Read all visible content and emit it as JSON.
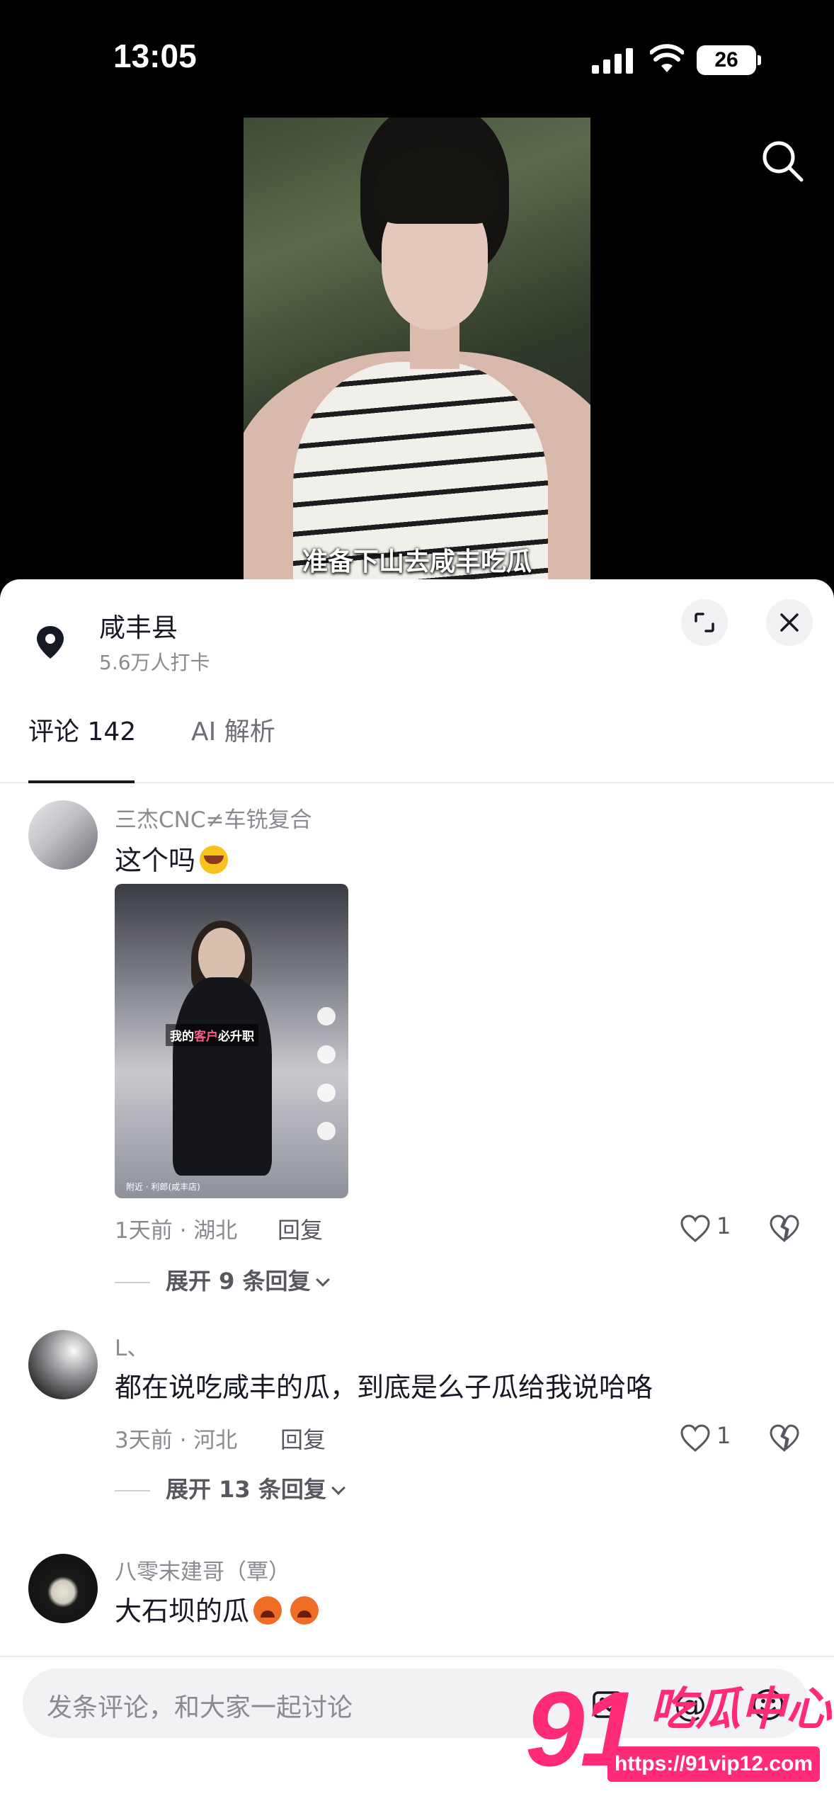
{
  "status_bar": {
    "time": "13:05",
    "battery": "26"
  },
  "video": {
    "caption": "准备下山去咸丰吃瓜"
  },
  "location": {
    "title": "咸丰县",
    "subtitle": "5.6万人打卡"
  },
  "tabs": [
    {
      "label": "评论 142"
    },
    {
      "label": "AI 解析"
    }
  ],
  "comments": [
    {
      "user": "三杰CNC≠车铣复合",
      "text": "这个吗",
      "emoji": "laughing-crying-emoji",
      "thumbnail": {
        "label_pre": "我的",
        "label_hl": "客户",
        "label_post": "必升职",
        "tag": "附近 · 利郎(咸丰店)"
      },
      "meta": "1天前 · 湖北",
      "reply_label": "回复",
      "likes": "1",
      "expand_label": "展开 9 条回复"
    },
    {
      "user": "L、",
      "text": "都在说吃咸丰的瓜，到底是么子瓜给我说哈咯",
      "meta": "3天前 · 河北",
      "reply_label": "回复",
      "likes": "1",
      "expand_label": "展开 13 条回复"
    },
    {
      "user": "八零末建哥（覃）",
      "text": "大石坝的瓜",
      "emoji": "angry-face-emoji"
    }
  ],
  "input": {
    "placeholder": "发条评论，和大家一起讨论",
    "at_symbol": "@"
  },
  "watermark": {
    "number": "91",
    "text": "吃瓜中心",
    "url": "https://91vip12.com"
  },
  "colors": {
    "accent": "#ff2a78",
    "text_primary": "#161823",
    "text_secondary": "#8a8b91"
  }
}
